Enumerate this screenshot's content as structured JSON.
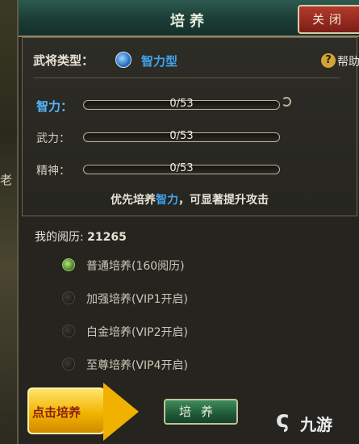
{
  "background": {
    "left_text": "老"
  },
  "dialog": {
    "title": "培养",
    "close_label": "关闭"
  },
  "general": {
    "type_label": "武将类型：",
    "type_value": "智力型",
    "help_label": "帮助"
  },
  "attributes": [
    {
      "label": "智力：",
      "value": "0/53",
      "progress": 0,
      "active": true
    },
    {
      "label": "武力：",
      "value": "0/53",
      "progress": 0,
      "active": false
    },
    {
      "label": "精神：",
      "value": "0/53",
      "progress": 0,
      "active": false
    }
  ],
  "hint": {
    "prefix": "优先培养",
    "highlight": "智力",
    "suffix": "，可显著提升攻击"
  },
  "experience": {
    "label": "我的阅历:",
    "value": "21265"
  },
  "options": [
    {
      "label": "普通培养(160阅历)",
      "selected": true
    },
    {
      "label": "加强培养(VIP1开启)",
      "selected": false
    },
    {
      "label": "白金培养(VIP2开启)",
      "selected": false
    },
    {
      "label": "至尊培养(VIP4开启)",
      "selected": false
    }
  ],
  "callout": {
    "text": "点击培养"
  },
  "train_button": {
    "label": "培养"
  },
  "watermark": {
    "icon": "ς",
    "text": "九游"
  },
  "colors": {
    "accent_blue": "#3fa5f0",
    "title_green": "#1b3d35",
    "close_red": "#b23a2c",
    "callout_yellow": "#f2b500"
  }
}
